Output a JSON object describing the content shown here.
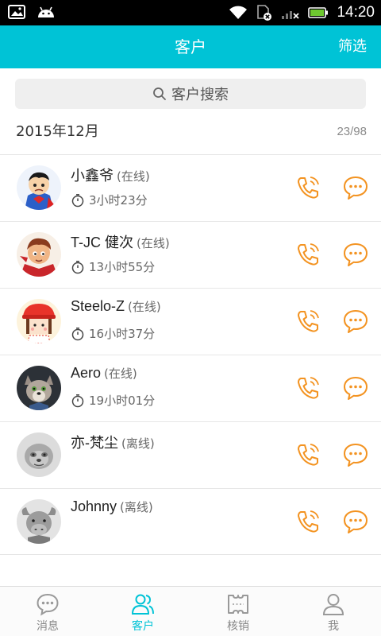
{
  "status_bar": {
    "time": "14:20"
  },
  "header": {
    "title": "客户",
    "action": "筛选"
  },
  "search": {
    "placeholder": "客户搜索"
  },
  "month": {
    "label": "2015年12月",
    "count": "23/98"
  },
  "customers": [
    {
      "name": "小鑫爷",
      "status": "(在线)",
      "duration": "3小时23分",
      "avatar": "superman-avatar"
    },
    {
      "name": "T-JC 健次",
      "status": "(在线)",
      "duration": "13小时55分",
      "avatar": "cartoon-boy-avatar"
    },
    {
      "name": "Steelo-Z",
      "status": "(在线)",
      "duration": "16小时37分",
      "avatar": "red-hat-girl-avatar"
    },
    {
      "name": "Aero",
      "status": "(在线)",
      "duration": "19小时01分",
      "avatar": "fox-avatar"
    },
    {
      "name": "亦-梵尘",
      "status": "(离线)",
      "duration": "",
      "avatar": "sloth-avatar"
    },
    {
      "name": "Johnny",
      "status": "(离线)",
      "duration": "",
      "avatar": "buffalo-avatar"
    }
  ],
  "bottom_nav": [
    {
      "label": "消息",
      "icon": "chat-bubble-icon",
      "active": false
    },
    {
      "label": "客户",
      "icon": "people-icon",
      "active": true
    },
    {
      "label": "核销",
      "icon": "ticket-icon",
      "active": false
    },
    {
      "label": "我",
      "icon": "person-icon",
      "active": false
    }
  ],
  "colors": {
    "accent": "#00c3d6",
    "action": "#f39321"
  }
}
